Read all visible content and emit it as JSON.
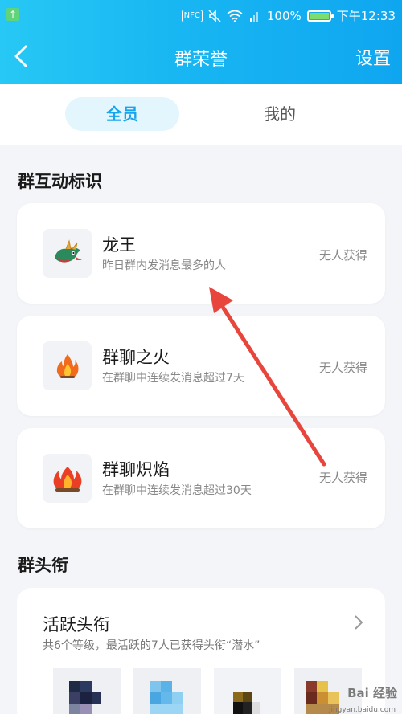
{
  "status_bar": {
    "nfc": "NFC",
    "battery_text": "100%",
    "battery_level": 1.0,
    "time": "下午12:33"
  },
  "navbar": {
    "title": "群荣誉",
    "settings": "设置"
  },
  "tabs": [
    {
      "label": "全员",
      "active": true
    },
    {
      "label": "我的",
      "active": false
    }
  ],
  "sections": {
    "interaction": "群互动标识",
    "titles": "群头衔"
  },
  "badges": [
    {
      "name": "龙王",
      "desc": "昨日群内发消息最多的人",
      "state": "无人获得",
      "icon": "dragon-icon"
    },
    {
      "name": "群聊之火",
      "desc": "在群聊中连续发消息超过7天",
      "state": "无人获得",
      "icon": "fire-icon"
    },
    {
      "name": "群聊炽焰",
      "desc": "在群聊中连续发消息超过30天",
      "state": "无人获得",
      "icon": "blaze-icon"
    }
  ],
  "active_title": {
    "name": "活跃头衔",
    "desc": "共6个等级，最活跃的7人已获得头衔“潜水”"
  },
  "watermark": {
    "text": "Bai 经验",
    "sub": "jingyan.baidu.com"
  },
  "colors": {
    "header_start": "#27c8f5",
    "header_end": "#0fa6f0",
    "accent": "#15a4ee",
    "arrow": "#e8453c"
  }
}
